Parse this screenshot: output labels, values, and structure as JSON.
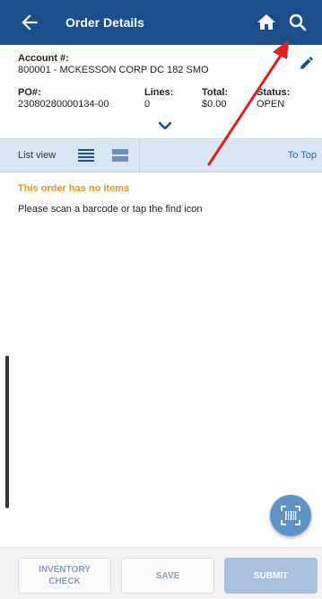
{
  "header": {
    "title": "Order Details",
    "back_icon": "arrow-left-icon",
    "home_icon": "home-icon",
    "search_icon": "search-icon"
  },
  "order": {
    "account_label": "Account #:",
    "account_value": "800001 - MCKESSON CORP DC 182 SMO",
    "po_label": "PO#:",
    "po_value": "23080280000134-00",
    "lines_label": "Lines:",
    "lines_value": "0",
    "total_label": "Total:",
    "total_value": "$0.00",
    "status_label": "Status:",
    "status_value": "OPEN"
  },
  "viewbar": {
    "list_label": "List view",
    "to_top_label": "To Top"
  },
  "messages": {
    "no_items": "This order has no items",
    "hint": "Please scan a barcode or tap the find icon"
  },
  "footer": {
    "inventory_check_line1": "INVENTORY",
    "inventory_check_line2": "CHECK",
    "save_label": "SAVE",
    "submit_label": "SUBMIT"
  },
  "colors": {
    "header_bg": "#1d4e8c",
    "warning": "#e7931b",
    "accent": "#5f92c9",
    "annotation_arrow": "#e02020"
  }
}
